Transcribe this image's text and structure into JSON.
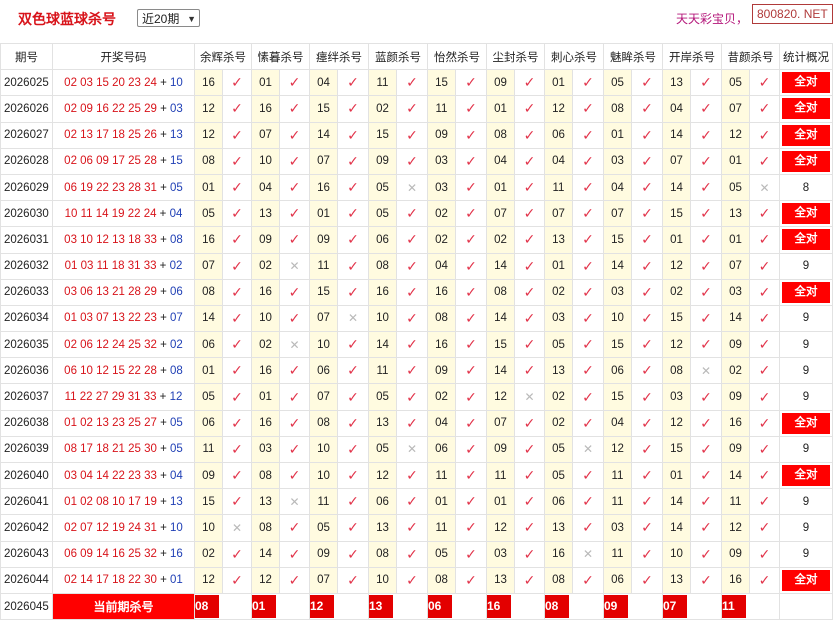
{
  "header": {
    "title": "双色球蓝球杀号",
    "period_select": "近20期",
    "promo": "天天彩宝贝，",
    "watermark": "800820. NET"
  },
  "columns": [
    "期号",
    "开奖号码",
    "余辉杀号",
    "愫暮杀号",
    "瘗绊杀号",
    "蓝颜杀号",
    "怡然杀号",
    "尘封杀号",
    "刺心杀号",
    "魅眸杀号",
    "开岸杀号",
    "昔颜杀号",
    "统计概况"
  ],
  "rows": [
    {
      "issue": "2026025",
      "red": "02 03 15 20 23 24",
      "blue": "10",
      "kills": [
        [
          "16",
          "ok"
        ],
        [
          "01",
          "ok"
        ],
        [
          "04",
          "ok"
        ],
        [
          "11",
          "ok"
        ],
        [
          "15",
          "ok"
        ],
        [
          "09",
          "ok"
        ],
        [
          "01",
          "ok"
        ],
        [
          "05",
          "ok"
        ],
        [
          "13",
          "ok"
        ],
        [
          "05",
          "ok"
        ]
      ],
      "summary": "全对"
    },
    {
      "issue": "2026026",
      "red": "02 09 16 22 25 29",
      "blue": "03",
      "kills": [
        [
          "12",
          "ok"
        ],
        [
          "16",
          "ok"
        ],
        [
          "15",
          "ok"
        ],
        [
          "02",
          "ok"
        ],
        [
          "11",
          "ok"
        ],
        [
          "01",
          "ok"
        ],
        [
          "12",
          "ok"
        ],
        [
          "08",
          "ok"
        ],
        [
          "04",
          "ok"
        ],
        [
          "07",
          "ok"
        ]
      ],
      "summary": "全对"
    },
    {
      "issue": "2026027",
      "red": "02 13 17 18 25 26",
      "blue": "13",
      "kills": [
        [
          "12",
          "ok"
        ],
        [
          "07",
          "ok"
        ],
        [
          "14",
          "ok"
        ],
        [
          "15",
          "ok"
        ],
        [
          "09",
          "ok"
        ],
        [
          "08",
          "ok"
        ],
        [
          "06",
          "ok"
        ],
        [
          "01",
          "ok"
        ],
        [
          "14",
          "ok"
        ],
        [
          "12",
          "ok"
        ]
      ],
      "summary": "全对"
    },
    {
      "issue": "2026028",
      "red": "02 06 09 17 25 28",
      "blue": "15",
      "kills": [
        [
          "08",
          "ok"
        ],
        [
          "10",
          "ok"
        ],
        [
          "07",
          "ok"
        ],
        [
          "09",
          "ok"
        ],
        [
          "03",
          "ok"
        ],
        [
          "04",
          "ok"
        ],
        [
          "04",
          "ok"
        ],
        [
          "03",
          "ok"
        ],
        [
          "07",
          "ok"
        ],
        [
          "01",
          "ok"
        ]
      ],
      "summary": "全对"
    },
    {
      "issue": "2026029",
      "red": "06 19 22 23 28 31",
      "blue": "05",
      "kills": [
        [
          "01",
          "ok"
        ],
        [
          "04",
          "ok"
        ],
        [
          "16",
          "ok"
        ],
        [
          "05",
          "no"
        ],
        [
          "03",
          "ok"
        ],
        [
          "01",
          "ok"
        ],
        [
          "11",
          "ok"
        ],
        [
          "04",
          "ok"
        ],
        [
          "14",
          "ok"
        ],
        [
          "05",
          "no"
        ]
      ],
      "summary": "8"
    },
    {
      "issue": "2026030",
      "red": "10 11 14 19 22 24",
      "blue": "04",
      "kills": [
        [
          "05",
          "ok"
        ],
        [
          "13",
          "ok"
        ],
        [
          "01",
          "ok"
        ],
        [
          "05",
          "ok"
        ],
        [
          "02",
          "ok"
        ],
        [
          "07",
          "ok"
        ],
        [
          "07",
          "ok"
        ],
        [
          "07",
          "ok"
        ],
        [
          "15",
          "ok"
        ],
        [
          "13",
          "ok"
        ]
      ],
      "summary": "全对"
    },
    {
      "issue": "2026031",
      "red": "03 10 12 13 18 33",
      "blue": "08",
      "kills": [
        [
          "16",
          "ok"
        ],
        [
          "09",
          "ok"
        ],
        [
          "09",
          "ok"
        ],
        [
          "06",
          "ok"
        ],
        [
          "02",
          "ok"
        ],
        [
          "02",
          "ok"
        ],
        [
          "13",
          "ok"
        ],
        [
          "15",
          "ok"
        ],
        [
          "01",
          "ok"
        ],
        [
          "01",
          "ok"
        ]
      ],
      "summary": "全对"
    },
    {
      "issue": "2026032",
      "red": "01 03 11 18 31 33",
      "blue": "02",
      "kills": [
        [
          "07",
          "ok"
        ],
        [
          "02",
          "no"
        ],
        [
          "11",
          "ok"
        ],
        [
          "08",
          "ok"
        ],
        [
          "04",
          "ok"
        ],
        [
          "14",
          "ok"
        ],
        [
          "01",
          "ok"
        ],
        [
          "14",
          "ok"
        ],
        [
          "12",
          "ok"
        ],
        [
          "07",
          "ok"
        ]
      ],
      "summary": "9"
    },
    {
      "issue": "2026033",
      "red": "03 06 13 21 28 29",
      "blue": "06",
      "kills": [
        [
          "08",
          "ok"
        ],
        [
          "16",
          "ok"
        ],
        [
          "15",
          "ok"
        ],
        [
          "16",
          "ok"
        ],
        [
          "16",
          "ok"
        ],
        [
          "08",
          "ok"
        ],
        [
          "02",
          "ok"
        ],
        [
          "03",
          "ok"
        ],
        [
          "02",
          "ok"
        ],
        [
          "03",
          "ok"
        ]
      ],
      "summary": "全对"
    },
    {
      "issue": "2026034",
      "red": "01 03 07 13 22 23",
      "blue": "07",
      "kills": [
        [
          "14",
          "ok"
        ],
        [
          "10",
          "ok"
        ],
        [
          "07",
          "no"
        ],
        [
          "10",
          "ok"
        ],
        [
          "08",
          "ok"
        ],
        [
          "14",
          "ok"
        ],
        [
          "03",
          "ok"
        ],
        [
          "10",
          "ok"
        ],
        [
          "15",
          "ok"
        ],
        [
          "14",
          "ok"
        ]
      ],
      "summary": "9"
    },
    {
      "issue": "2026035",
      "red": "02 06 12 24 25 32",
      "blue": "02",
      "kills": [
        [
          "06",
          "ok"
        ],
        [
          "02",
          "no"
        ],
        [
          "10",
          "ok"
        ],
        [
          "14",
          "ok"
        ],
        [
          "16",
          "ok"
        ],
        [
          "15",
          "ok"
        ],
        [
          "05",
          "ok"
        ],
        [
          "15",
          "ok"
        ],
        [
          "12",
          "ok"
        ],
        [
          "09",
          "ok"
        ]
      ],
      "summary": "9"
    },
    {
      "issue": "2026036",
      "red": "06 10 12 15 22 28",
      "blue": "08",
      "kills": [
        [
          "01",
          "ok"
        ],
        [
          "16",
          "ok"
        ],
        [
          "06",
          "ok"
        ],
        [
          "11",
          "ok"
        ],
        [
          "09",
          "ok"
        ],
        [
          "14",
          "ok"
        ],
        [
          "13",
          "ok"
        ],
        [
          "06",
          "ok"
        ],
        [
          "08",
          "no"
        ],
        [
          "02",
          "ok"
        ]
      ],
      "summary": "9"
    },
    {
      "issue": "2026037",
      "red": "11 22 27 29 31 33",
      "blue": "12",
      "kills": [
        [
          "05",
          "ok"
        ],
        [
          "01",
          "ok"
        ],
        [
          "07",
          "ok"
        ],
        [
          "05",
          "ok"
        ],
        [
          "02",
          "ok"
        ],
        [
          "12",
          "no"
        ],
        [
          "02",
          "ok"
        ],
        [
          "15",
          "ok"
        ],
        [
          "03",
          "ok"
        ],
        [
          "09",
          "ok"
        ]
      ],
      "summary": "9"
    },
    {
      "issue": "2026038",
      "red": "01 02 13 23 25 27",
      "blue": "05",
      "kills": [
        [
          "06",
          "ok"
        ],
        [
          "16",
          "ok"
        ],
        [
          "08",
          "ok"
        ],
        [
          "13",
          "ok"
        ],
        [
          "04",
          "ok"
        ],
        [
          "07",
          "ok"
        ],
        [
          "02",
          "ok"
        ],
        [
          "04",
          "ok"
        ],
        [
          "12",
          "ok"
        ],
        [
          "16",
          "ok"
        ]
      ],
      "summary": "全对"
    },
    {
      "issue": "2026039",
      "red": "08 17 18 21 25 30",
      "blue": "05",
      "kills": [
        [
          "11",
          "ok"
        ],
        [
          "03",
          "ok"
        ],
        [
          "10",
          "ok"
        ],
        [
          "05",
          "no"
        ],
        [
          "06",
          "ok"
        ],
        [
          "09",
          "ok"
        ],
        [
          "05",
          "no"
        ],
        [
          "12",
          "ok"
        ],
        [
          "15",
          "ok"
        ],
        [
          "09",
          "ok"
        ]
      ],
      "summary": "9"
    },
    {
      "issue": "2026040",
      "red": "03 04 14 22 23 33",
      "blue": "04",
      "kills": [
        [
          "09",
          "ok"
        ],
        [
          "08",
          "ok"
        ],
        [
          "10",
          "ok"
        ],
        [
          "12",
          "ok"
        ],
        [
          "11",
          "ok"
        ],
        [
          "11",
          "ok"
        ],
        [
          "05",
          "ok"
        ],
        [
          "11",
          "ok"
        ],
        [
          "01",
          "ok"
        ],
        [
          "14",
          "ok"
        ]
      ],
      "summary": "全对"
    },
    {
      "issue": "2026041",
      "red": "01 02 08 10 17 19",
      "blue": "13",
      "kills": [
        [
          "15",
          "ok"
        ],
        [
          "13",
          "no"
        ],
        [
          "11",
          "ok"
        ],
        [
          "06",
          "ok"
        ],
        [
          "01",
          "ok"
        ],
        [
          "01",
          "ok"
        ],
        [
          "06",
          "ok"
        ],
        [
          "11",
          "ok"
        ],
        [
          "14",
          "ok"
        ],
        [
          "11",
          "ok"
        ]
      ],
      "summary": "9"
    },
    {
      "issue": "2026042",
      "red": "02 07 12 19 24 31",
      "blue": "10",
      "kills": [
        [
          "10",
          "no"
        ],
        [
          "08",
          "ok"
        ],
        [
          "05",
          "ok"
        ],
        [
          "13",
          "ok"
        ],
        [
          "11",
          "ok"
        ],
        [
          "12",
          "ok"
        ],
        [
          "13",
          "ok"
        ],
        [
          "03",
          "ok"
        ],
        [
          "14",
          "ok"
        ],
        [
          "12",
          "ok"
        ]
      ],
      "summary": "9"
    },
    {
      "issue": "2026043",
      "red": "06 09 14 16 25 32",
      "blue": "16",
      "kills": [
        [
          "02",
          "ok"
        ],
        [
          "14",
          "ok"
        ],
        [
          "09",
          "ok"
        ],
        [
          "08",
          "ok"
        ],
        [
          "05",
          "ok"
        ],
        [
          "03",
          "ok"
        ],
        [
          "16",
          "no"
        ],
        [
          "11",
          "ok"
        ],
        [
          "10",
          "ok"
        ],
        [
          "09",
          "ok"
        ]
      ],
      "summary": "9"
    },
    {
      "issue": "2026044",
      "red": "02 14 17 18 22 30",
      "blue": "01",
      "kills": [
        [
          "12",
          "ok"
        ],
        [
          "12",
          "ok"
        ],
        [
          "07",
          "ok"
        ],
        [
          "10",
          "ok"
        ],
        [
          "08",
          "ok"
        ],
        [
          "13",
          "ok"
        ],
        [
          "08",
          "ok"
        ],
        [
          "06",
          "ok"
        ],
        [
          "13",
          "ok"
        ],
        [
          "16",
          "ok"
        ]
      ],
      "summary": "全对"
    }
  ],
  "current": {
    "issue": "2026045",
    "label": "当前期杀号",
    "kills": [
      "08",
      "01",
      "12",
      "13",
      "06",
      "16",
      "08",
      "09",
      "07",
      "11"
    ]
  },
  "marks": {
    "ok": "✓",
    "no": "✕"
  },
  "colors": {
    "red": "#d8131a",
    "blue": "#1f3fb5",
    "highlight": "#ff0000",
    "kill_bg": "#fffbe0"
  }
}
